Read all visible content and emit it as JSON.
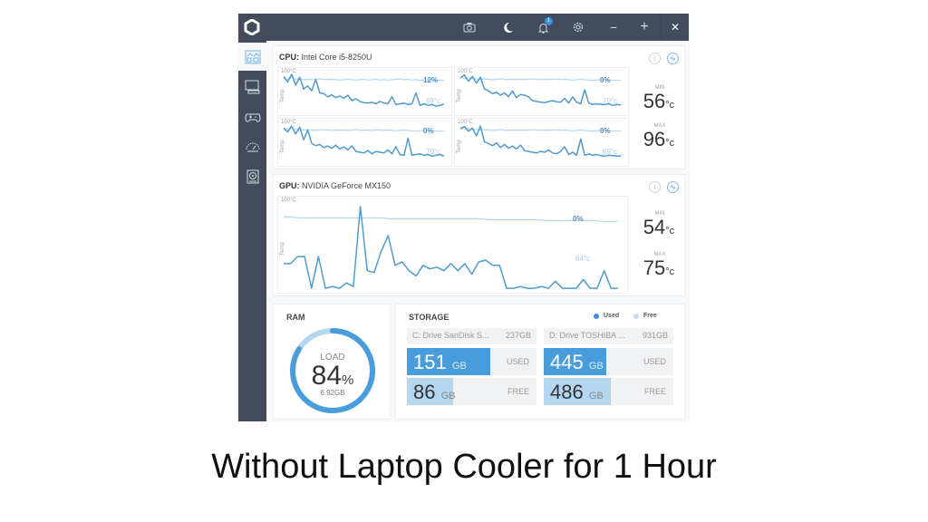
{
  "window": {
    "titlebar_icons": [
      "camera-icon",
      "moon-icon",
      "bell-icon",
      "gear-icon",
      "minimize-icon",
      "maximize-icon",
      "close-icon"
    ],
    "notification_count": "1",
    "glyphs": {
      "camera": "⌷",
      "moon": "☾",
      "bell": "♫",
      "gear": "⚙",
      "minimize": "−",
      "maximize": "+",
      "close": "✕"
    }
  },
  "sidebar": {
    "items": [
      {
        "name": "dashboard",
        "active": true
      },
      {
        "name": "system",
        "active": false
      },
      {
        "name": "gaming",
        "active": false
      },
      {
        "name": "speed",
        "active": false
      },
      {
        "name": "storage",
        "active": false
      }
    ]
  },
  "cpu": {
    "label": "CPU:",
    "name": "Intel Core i5-8250U",
    "min_label": "MIN",
    "min_value": "56",
    "max_label": "MAX",
    "max_value": "96",
    "unit": "°c",
    "graphs": [
      {
        "top_label": "100°C",
        "axis_label": "Temp",
        "usage": "12%",
        "temp": "69°c",
        "usage_series": [
          88,
          86,
          90,
          86,
          85,
          84,
          85,
          84,
          85,
          86,
          85,
          84,
          85,
          84,
          83,
          84,
          85,
          84,
          83,
          84,
          85,
          83,
          84,
          85,
          83,
          84,
          83,
          84,
          85,
          86,
          84,
          85,
          83,
          84,
          82,
          83,
          84,
          83,
          82,
          83,
          82
        ],
        "temp_series": [
          92,
          78,
          98,
          70,
          90,
          60,
          68,
          55,
          85,
          50,
          48,
          40,
          45,
          38,
          42,
          36,
          44,
          30,
          35,
          28,
          25,
          24,
          26,
          22,
          28,
          24,
          22,
          40,
          20,
          22,
          24,
          20,
          22,
          50,
          18,
          22,
          18,
          20,
          16,
          18,
          22
        ]
      },
      {
        "top_label": "100°C",
        "axis_label": "Temp",
        "usage": "0%",
        "temp": "70°c",
        "usage_series": [
          90,
          88,
          89,
          87,
          86,
          85,
          86,
          85,
          84,
          85,
          86,
          85,
          84,
          85,
          84,
          85,
          84,
          85,
          86,
          85,
          84,
          85,
          84,
          85,
          86,
          84,
          85,
          84,
          83,
          84,
          85,
          84,
          83,
          82,
          83,
          84,
          83,
          82,
          83,
          82,
          83
        ],
        "temp_series": [
          88,
          96,
          80,
          92,
          75,
          90,
          60,
          55,
          48,
          52,
          44,
          50,
          40,
          55,
          38,
          46,
          44,
          40,
          30,
          28,
          26,
          25,
          28,
          30,
          27,
          26,
          36,
          24,
          40,
          26,
          22,
          58,
          24,
          20,
          22,
          21,
          20,
          22,
          18,
          20,
          19
        ]
      },
      {
        "top_label": "100°C",
        "axis_label": "Temp",
        "usage": "0%",
        "temp": "70°c",
        "usage_series": [
          86,
          88,
          90,
          86,
          87,
          85,
          86,
          85,
          84,
          85,
          86,
          85,
          84,
          85,
          84,
          85,
          84,
          85,
          86,
          85,
          84,
          85,
          84,
          85,
          86,
          84,
          85,
          84,
          83,
          84,
          85,
          84,
          83,
          82,
          83,
          84,
          83,
          82,
          83,
          82,
          83
        ],
        "temp_series": [
          90,
          80,
          95,
          75,
          92,
          60,
          85,
          50,
          45,
          48,
          40,
          44,
          38,
          46,
          36,
          42,
          34,
          44,
          30,
          28,
          26,
          32,
          24,
          30,
          28,
          26,
          34,
          24,
          42,
          22,
          20,
          64,
          20,
          22,
          24,
          20,
          22,
          18,
          20,
          22,
          18
        ]
      },
      {
        "top_label": "100°C",
        "axis_label": "Temp",
        "usage": "0%",
        "temp": "69°c",
        "usage_series": [
          90,
          88,
          89,
          87,
          86,
          85,
          86,
          85,
          84,
          85,
          86,
          85,
          84,
          85,
          84,
          85,
          84,
          85,
          86,
          85,
          84,
          85,
          84,
          85,
          86,
          84,
          85,
          84,
          83,
          84,
          85,
          84,
          83,
          82,
          83,
          84,
          83,
          82,
          83,
          82,
          83
        ],
        "temp_series": [
          88,
          94,
          82,
          90,
          70,
          95,
          55,
          50,
          45,
          52,
          40,
          48,
          38,
          44,
          36,
          46,
          32,
          30,
          28,
          26,
          30,
          28,
          34,
          26,
          24,
          30,
          42,
          22,
          28,
          20,
          62,
          20,
          24,
          20,
          22,
          19,
          18,
          20,
          19,
          18,
          18
        ]
      }
    ]
  },
  "gpu": {
    "label": "GPU:",
    "name": "NVIDIA GeForce MX150",
    "top_label": "100°C",
    "axis_label": "Temp",
    "usage": "0%",
    "temp": "64°c",
    "min_label": "MIN",
    "min_value": "54",
    "max_label": "MAX",
    "max_value": "75",
    "unit": "°c",
    "usage_series": [
      83,
      83,
      82,
      82,
      82,
      82,
      82,
      82,
      82,
      82,
      82,
      82,
      82,
      81,
      81,
      81,
      81,
      81,
      81,
      81,
      81,
      81,
      81,
      81,
      81,
      80,
      80,
      80,
      80,
      80,
      80,
      80,
      79,
      79,
      79,
      79,
      79,
      79,
      79,
      78,
      78,
      78
    ],
    "temp_series": [
      30,
      30,
      38,
      38,
      2,
      38,
      2,
      4,
      2,
      8,
      4,
      95,
      22,
      20,
      44,
      62,
      28,
      32,
      22,
      16,
      28,
      24,
      26,
      22,
      30,
      22,
      30,
      18,
      32,
      34,
      28,
      28,
      2,
      2,
      4,
      2,
      2,
      4,
      2,
      10,
      2,
      2,
      2,
      12,
      2,
      2,
      22,
      2,
      2
    ]
  },
  "ram": {
    "title": "RAM",
    "load_label": "LOAD",
    "load_value": "84",
    "load_unit": "%",
    "load_fraction": 0.84,
    "used": "6.92GB"
  },
  "storage": {
    "title": "STORAGE",
    "legend_used": "Used",
    "legend_free": "Free",
    "colors": {
      "used": "#4a9ddc",
      "free": "#b5d6ef"
    },
    "drives": [
      {
        "name": "C: Drive SanDisk S...",
        "size": "237GB",
        "used": "151",
        "free": "86",
        "unit": "GB",
        "used_label": "USED",
        "free_label": "FREE",
        "used_fraction": 0.64,
        "free_fraction": 0.36
      },
      {
        "name": "D: Drive TOSHIBA ...",
        "size": "931GB",
        "used": "445",
        "free": "486",
        "unit": "GB",
        "used_label": "USED",
        "free_label": "FREE",
        "used_fraction": 0.48,
        "free_fraction": 0.52
      }
    ]
  },
  "caption": "Without Laptop Cooler for 1 Hour"
}
